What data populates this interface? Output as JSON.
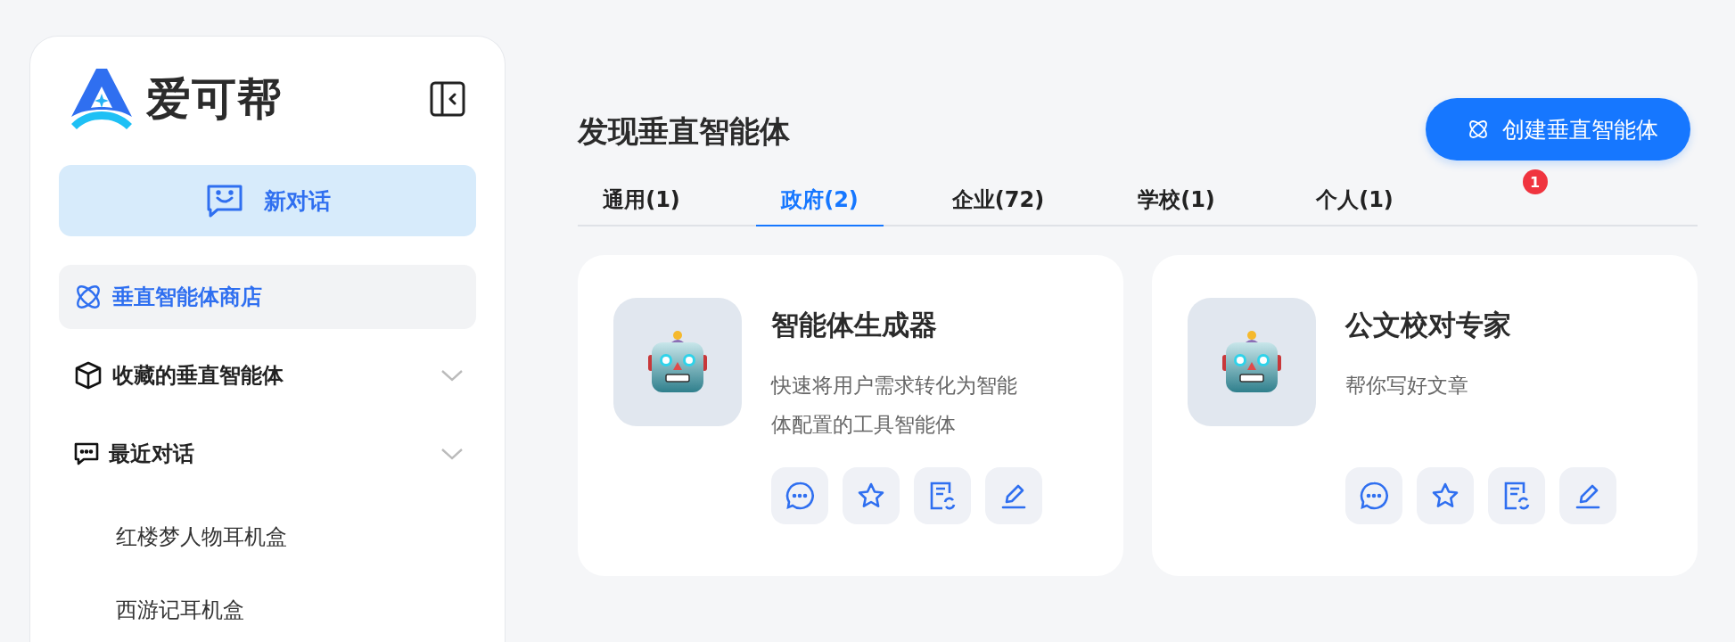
{
  "sidebar": {
    "logo_text": "爱可帮",
    "new_chat_button": "新对话",
    "nav": [
      {
        "kind": "link",
        "label": "垂直智能体商店",
        "selected": true
      },
      {
        "kind": "group",
        "label": "收藏的垂直智能体",
        "selected": false
      },
      {
        "kind": "group",
        "label": "最近对话",
        "selected": false,
        "children": [
          {
            "label": "红楼梦人物耳机盒"
          },
          {
            "label": "西游记耳机盒"
          }
        ]
      }
    ]
  },
  "main": {
    "title": "发现垂直智能体",
    "create_button": "创建垂直智能体",
    "badge": "1",
    "tabs": [
      {
        "label": "通用(1)",
        "selected": false
      },
      {
        "label": "政府(2)",
        "selected": true
      },
      {
        "label": "企业(72)",
        "selected": false
      },
      {
        "label": "学校(1)",
        "selected": false
      },
      {
        "label": "个人(1)",
        "selected": false
      }
    ],
    "agents": [
      {
        "name": "智能体生成器",
        "description": "快速将用户需求转化为智能体配置的工具智能体"
      },
      {
        "name": "公文校对专家",
        "description": "帮你写好文章"
      }
    ]
  }
}
